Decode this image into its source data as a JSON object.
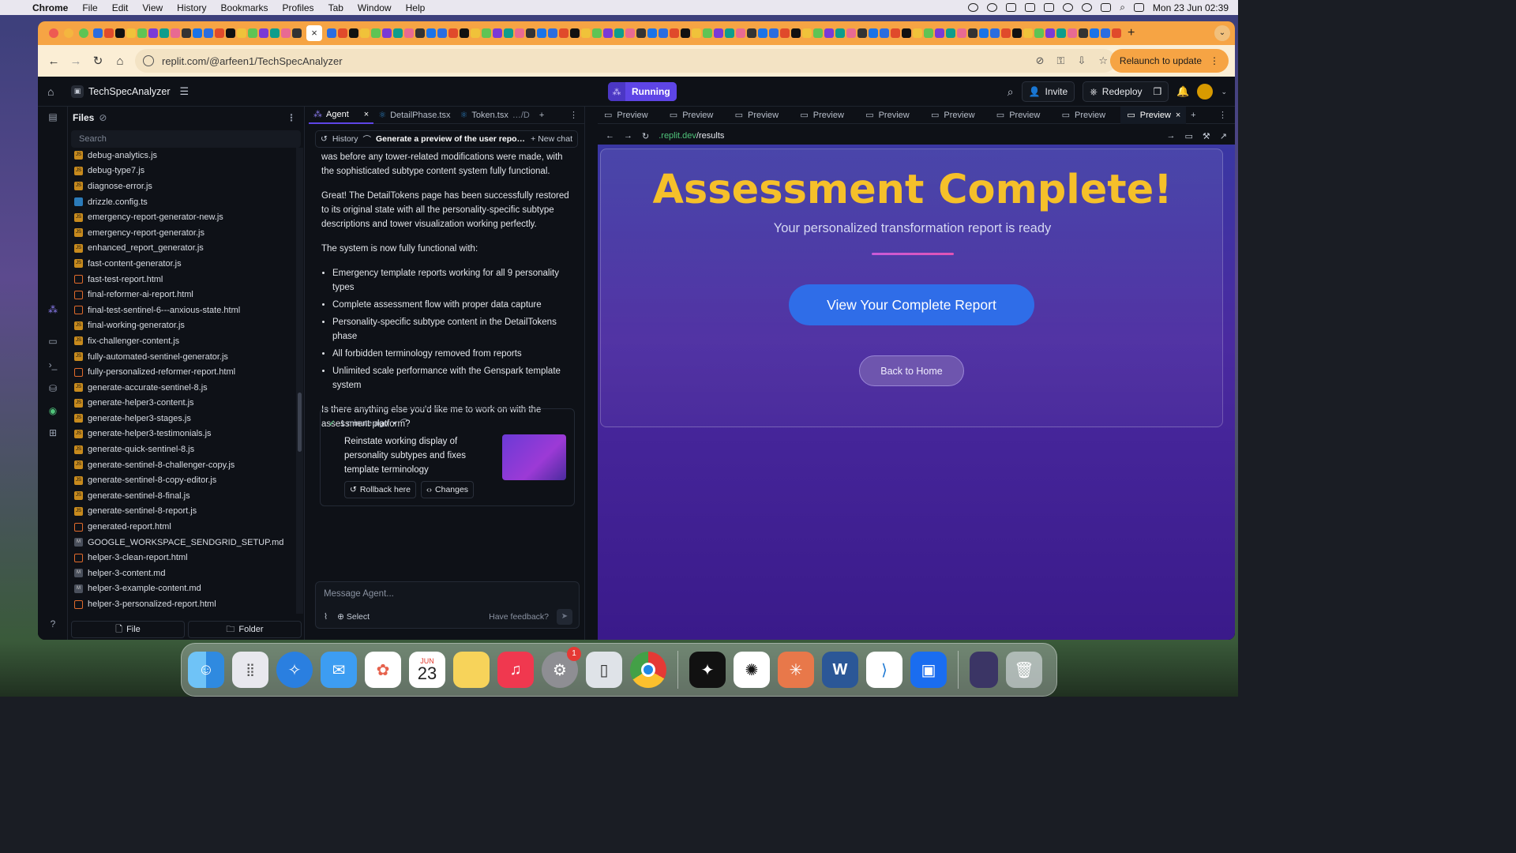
{
  "menubar": {
    "app": "Chrome",
    "items": [
      "File",
      "Edit",
      "View",
      "History",
      "Bookmarks",
      "Profiles",
      "Tab",
      "Window",
      "Help"
    ],
    "clock": "Mon 23 Jun  02:39"
  },
  "browser": {
    "url": "replit.com/@arfeen1/TechSpecAnalyzer",
    "relaunch": "Relaunch to update"
  },
  "replit": {
    "project": "TechSpecAnalyzer",
    "status": "Running",
    "invite": "Invite",
    "redeploy": "Redeploy"
  },
  "files": {
    "title": "Files",
    "search_placeholder": "Search",
    "items": [
      {
        "name": "debug-analytics.js",
        "type": "js"
      },
      {
        "name": "debug-type7.js",
        "type": "js"
      },
      {
        "name": "diagnose-error.js",
        "type": "js"
      },
      {
        "name": "drizzle.config.ts",
        "type": "ts"
      },
      {
        "name": "emergency-report-generator-new.js",
        "type": "js"
      },
      {
        "name": "emergency-report-generator.js",
        "type": "js"
      },
      {
        "name": "enhanced_report_generator.js",
        "type": "js"
      },
      {
        "name": "fast-content-generator.js",
        "type": "js"
      },
      {
        "name": "fast-test-report.html",
        "type": "html"
      },
      {
        "name": "final-reformer-ai-report.html",
        "type": "html"
      },
      {
        "name": "final-test-sentinel-6---anxious-state.html",
        "type": "html"
      },
      {
        "name": "final-working-generator.js",
        "type": "js"
      },
      {
        "name": "fix-challenger-content.js",
        "type": "js"
      },
      {
        "name": "fully-automated-sentinel-generator.js",
        "type": "js"
      },
      {
        "name": "fully-personalized-reformer-report.html",
        "type": "html"
      },
      {
        "name": "generate-accurate-sentinel-8.js",
        "type": "js"
      },
      {
        "name": "generate-helper3-content.js",
        "type": "js"
      },
      {
        "name": "generate-helper3-stages.js",
        "type": "js"
      },
      {
        "name": "generate-helper3-testimonials.js",
        "type": "js"
      },
      {
        "name": "generate-quick-sentinel-8.js",
        "type": "js"
      },
      {
        "name": "generate-sentinel-8-challenger-copy.js",
        "type": "js"
      },
      {
        "name": "generate-sentinel-8-copy-editor.js",
        "type": "js"
      },
      {
        "name": "generate-sentinel-8-final.js",
        "type": "js"
      },
      {
        "name": "generate-sentinel-8-report.js",
        "type": "js"
      },
      {
        "name": "generated-report.html",
        "type": "html"
      },
      {
        "name": "GOOGLE_WORKSPACE_SENDGRID_SETUP.md",
        "type": "md"
      },
      {
        "name": "helper-3-clean-report.html",
        "type": "html"
      },
      {
        "name": "helper-3-content.md",
        "type": "md"
      },
      {
        "name": "helper-3-example-content.md",
        "type": "md"
      },
      {
        "name": "helper-3-personalized-report.html",
        "type": "html"
      }
    ],
    "new_file": "File",
    "new_folder": "Folder"
  },
  "agent": {
    "tabs": [
      "Agent",
      "DetailPhase.tsx",
      "Token.tsx",
      "…/D"
    ],
    "history": "History",
    "current_chat": "Generate a preview of the user report b...",
    "new_chat": "New chat",
    "para0": "was before any tower-related modifications were made, with the sophisticated subtype content system fully functional.",
    "para1": "Great! The DetailTokens page has been successfully restored to its original state with all the personality-specific subtype descriptions and tower visualization working perfectly.",
    "para2": "The system is now fully functional with:",
    "bullets": [
      "Emergency template reports working for all 9 personality types",
      "Complete assessment flow with proper data capture",
      "Personality-specific subtype content in the DetailTokens phase",
      "All forbidden terminology removed from reports",
      "Unlimited scale performance with the Genspark template system"
    ],
    "para3": "Is there anything else you'd like me to work on with the assessment platform?",
    "checkpoint": {
      "time": "1 minute ago",
      "title": "Reinstate working display of personality subtypes and fixes template terminology",
      "rollback": "Rollback here",
      "changes": "Changes"
    },
    "input_placeholder": "Message Agent...",
    "select": "Select",
    "feedback": "Have feedback?"
  },
  "preview": {
    "tab_label": "Preview",
    "url_host": ".replit.dev",
    "url_path": "/results",
    "heading": "Assessment Complete!",
    "subheading": "Your personalized transformation report is ready",
    "primary_button": "View Your Complete Report",
    "secondary_button": "Back to Home"
  },
  "dock": {
    "calendar_month": "JUN",
    "calendar_day": "23",
    "settings_badge": "1"
  }
}
